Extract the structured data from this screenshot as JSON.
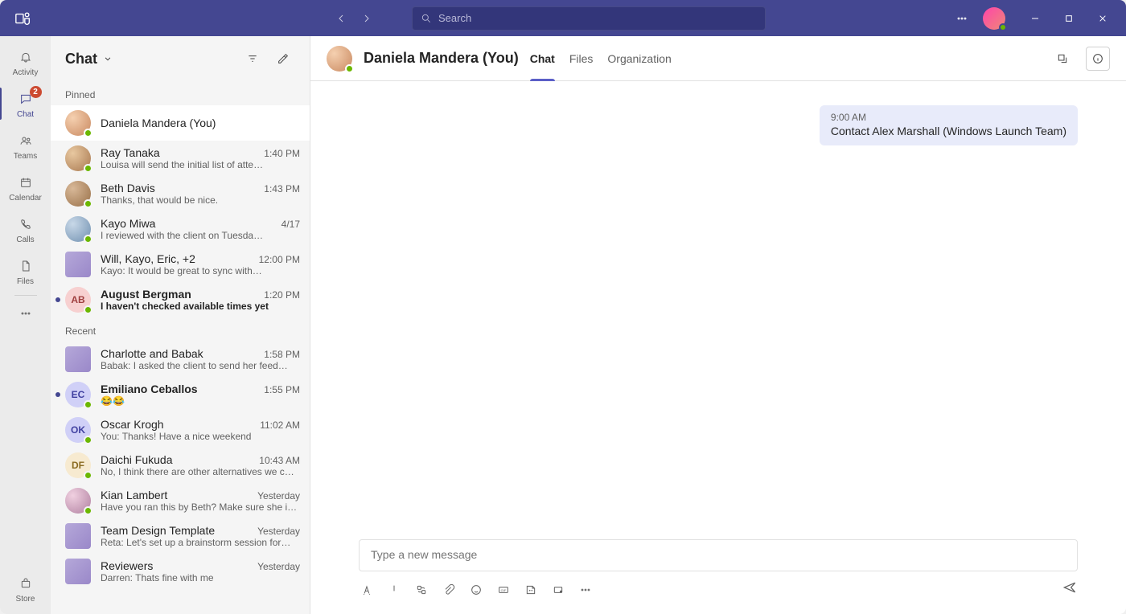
{
  "search": {
    "placeholder": "Search"
  },
  "rail": {
    "chat_badge": "2",
    "items": {
      "activity": "Activity",
      "chat": "Chat",
      "teams": "Teams",
      "calendar": "Calendar",
      "calls": "Calls",
      "files": "Files",
      "store": "Store"
    }
  },
  "chatlist": {
    "title": "Chat",
    "sections": {
      "pinned": "Pinned",
      "recent": "Recent"
    },
    "pinned": [
      {
        "name": "Daniela Mandera (You)",
        "time": "",
        "preview": "",
        "avatar": "photo1",
        "selected": true
      },
      {
        "name": "Ray Tanaka",
        "time": "1:40 PM",
        "preview": "Louisa will send the initial list of atte…",
        "avatar": "photo2"
      },
      {
        "name": "Beth Davis",
        "time": "1:43 PM",
        "preview": "Thanks, that would be nice.",
        "avatar": "photo3"
      },
      {
        "name": "Kayo Miwa",
        "time": "4/17",
        "preview": "I reviewed with the client on Tuesda…",
        "avatar": "photo4"
      },
      {
        "name": "Will, Kayo, Eric, +2",
        "time": "12:00 PM",
        "preview": "Kayo: It would be great to sync with…",
        "avatar": "group"
      },
      {
        "name": "August Bergman",
        "time": "1:20 PM",
        "preview": "I haven't checked available times yet",
        "avatar": "initials-ab",
        "initials": "AB",
        "unread": true
      }
    ],
    "recent": [
      {
        "name": "Charlotte and Babak",
        "time": "1:58 PM",
        "preview": "Babak: I asked the client to send her feed…",
        "avatar": "group"
      },
      {
        "name": "Emiliano Ceballos",
        "time": "1:55 PM",
        "preview": "😂😂",
        "avatar": "initials-ec",
        "initials": "EC",
        "unread": true
      },
      {
        "name": "Oscar Krogh",
        "time": "11:02 AM",
        "preview": "You: Thanks! Have a nice weekend",
        "avatar": "initials-ok",
        "initials": "OK"
      },
      {
        "name": "Daichi Fukuda",
        "time": "10:43 AM",
        "preview": "No, I think there are other alternatives we c…",
        "avatar": "initials-df",
        "initials": "DF"
      },
      {
        "name": "Kian Lambert",
        "time": "Yesterday",
        "preview": "Have you ran this by Beth? Make sure she is…",
        "avatar": "photo5"
      },
      {
        "name": "Team Design Template",
        "time": "Yesterday",
        "preview": "Reta: Let's set up a brainstorm session for…",
        "avatar": "group"
      },
      {
        "name": "Reviewers",
        "time": "Yesterday",
        "preview": "Darren: Thats fine with me",
        "avatar": "group"
      }
    ]
  },
  "conversation": {
    "title": "Daniela Mandera (You)",
    "tabs": {
      "chat": "Chat",
      "files": "Files",
      "organization": "Organization"
    },
    "messages": [
      {
        "time": "9:00 AM",
        "text": "Contact Alex Marshall (Windows Launch Team)"
      }
    ],
    "composer": {
      "placeholder": "Type a new message"
    }
  }
}
